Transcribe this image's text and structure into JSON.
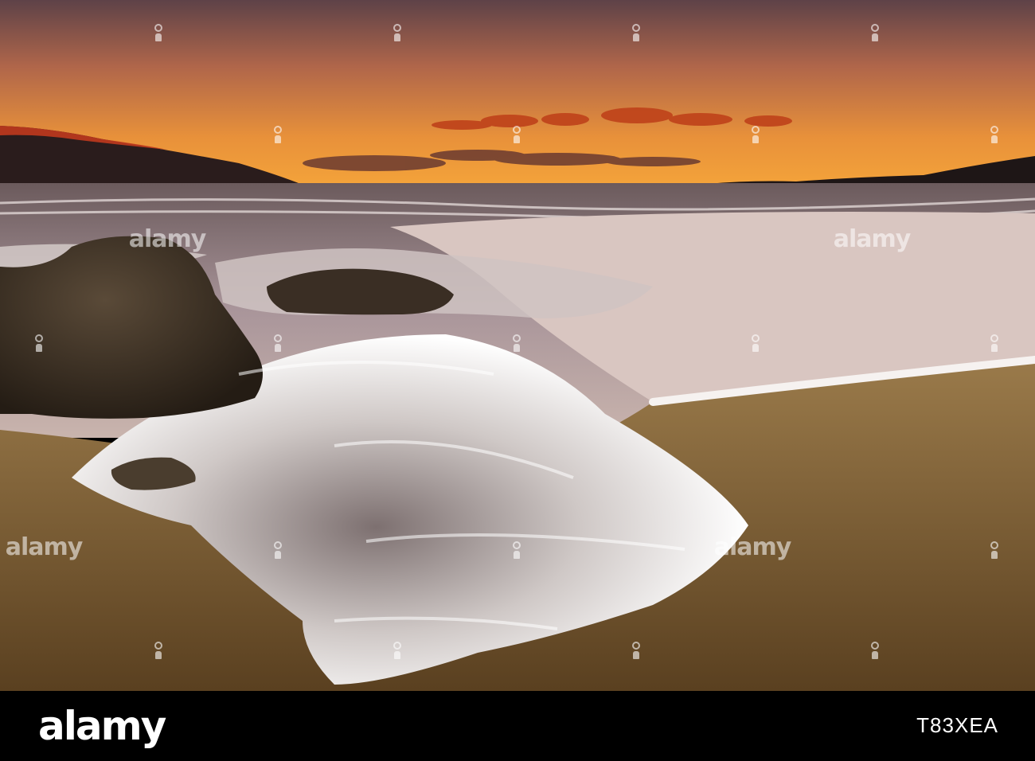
{
  "image": {
    "description_tags": [
      "sunset",
      "beach",
      "wave",
      "rocks",
      "sand"
    ],
    "colors": {
      "sky_top": "#6e4a4e",
      "sky_mid": "#e08a3c",
      "horizon_glow": "#f5a23a",
      "sea": "#8d7f86",
      "foam": "#f4f0ef",
      "sand": "#8a6a3a",
      "rock": "#3b2f25"
    }
  },
  "watermark": {
    "logo_text": "alamy",
    "image_id": "T83XEA"
  }
}
